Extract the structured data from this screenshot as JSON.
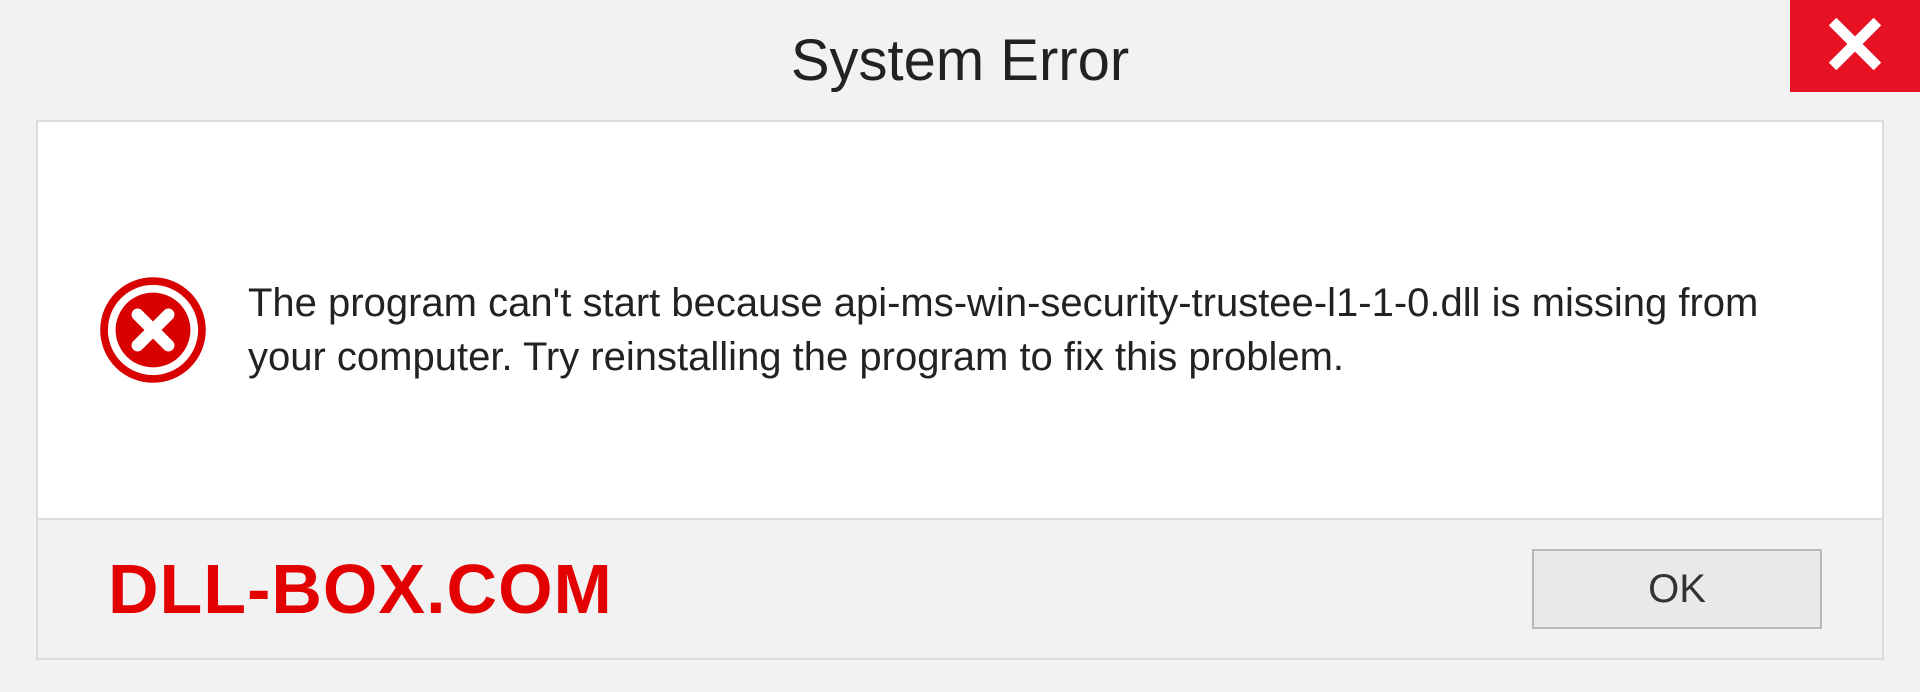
{
  "titlebar": {
    "title": "System Error"
  },
  "dialog": {
    "message": "The program can't start because api-ms-win-security-trustee-l1-1-0.dll is missing from your computer. Try reinstalling the program to fix this problem."
  },
  "footer": {
    "watermark": "DLL-BOX.COM",
    "ok_label": "OK"
  },
  "colors": {
    "close_bg": "#e81123",
    "error_icon": "#d90000",
    "watermark": "#e30000"
  }
}
